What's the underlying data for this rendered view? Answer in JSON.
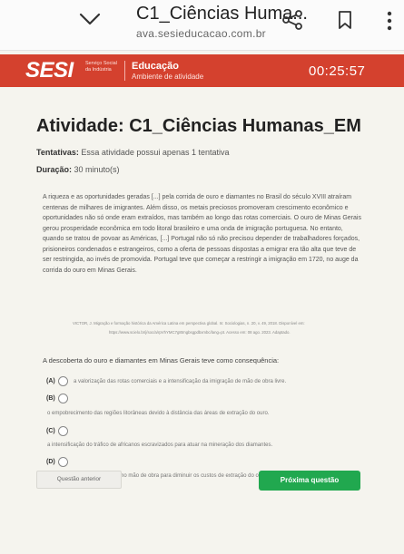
{
  "browser": {
    "title": "C1_Ciências Huma...",
    "url": "ava.sesieducacao.com.br"
  },
  "banner": {
    "logo": "SESI",
    "service_text": "Serviço Social da Indústria",
    "course": "Educação",
    "environment": "Ambiente de atividade",
    "timer": "00:25:57",
    "color": "#d4412e"
  },
  "page": {
    "title": "Atividade: C1_Ciências Humanas_EM",
    "attempts_label": "Tentativas:",
    "attempts_value": "Essa atividade possui apenas 1 tentativa",
    "duration_label": "Duração:",
    "duration_value": "30 minuto(s)"
  },
  "passage": {
    "text": "A riqueza e as oportunidades geradas [...] pela corrida de ouro e diamantes no Brasil do século XVIII atraíram centenas de milhares de imigrantes. Além disso, os metais preciosos promoveram crescimento econômico e oportunidades não só onde eram extraídos, mas também ao longo das rotas comerciais. O ouro de Minas Gerais gerou prosperidade econômica em todo litoral brasileiro e uma onda de imigração portuguesa. No entanto, quando se tratou de povoar as Américas, [...] Portugal não só não precisou depender de trabalhadores forçados, prisioneiros condenados e estrangeiros, como a oferta de pessoas dispostas a emigrar era tão alta que teve de ser restringida, ao invés de promovida. Portugal teve que começar a restringir a imigração em 1720, no auge da corrida do ouro em Minas Gerais.",
    "citation_line1": "VICTOR, J. Migração e formação histórica da América Latina em perspectiva global. In: Sociologias, n. 20, v. 49, 2018. Disponível em:",
    "citation_line2": "https://www.scielo.br/j/soc/a/rpVhYMC7g8trngbsgpdbxmbc/lang=pt. Acesso em: 08 ago. 2023. Adaptado."
  },
  "question": {
    "prompt": "A descoberta do ouro e diamantes em Minas Gerais teve como consequência:",
    "options": [
      {
        "label": "(A)",
        "text": "a valorização das rotas comerciais e a intensificação da imigração de mão de obra livre."
      },
      {
        "label": "(B)",
        "text": "o empobrecimento das regiões litorâneas devido à distância das áreas de extração do ouro."
      },
      {
        "label": "(C)",
        "text": "a intensificação do tráfico de africanos escravizados para atuar na mineração dos diamantes."
      },
      {
        "label": "(D)",
        "text": "o emprego de condenados como mão de obra para diminuir os custos de extração do ouro."
      }
    ]
  },
  "nav": {
    "prev_label": "Questão anterior",
    "next_label": "Próxima questão",
    "next_color": "#21a84f"
  }
}
